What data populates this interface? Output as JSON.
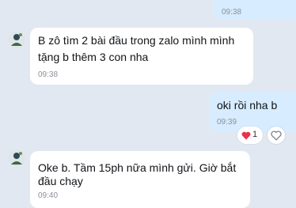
{
  "chat": {
    "messages": [
      {
        "sender": "self",
        "time": "09:38"
      },
      {
        "sender": "contact",
        "lines": [
          "B zô tìm 2 bài đầu trong zalo mình mình",
          "tặng b thêm 3 con nha"
        ],
        "time": "09:38"
      },
      {
        "sender": "self",
        "lines": [
          "oki rồi nha b"
        ],
        "time": "09:39",
        "reaction": {
          "icon": "heart-icon",
          "count": "1"
        }
      },
      {
        "sender": "contact",
        "lines": [
          "Oke b. Tầm 15ph nữa mình gửi. Giờ bắt",
          "đầu chạy"
        ],
        "time": "09:40"
      }
    ]
  },
  "colors": {
    "background": "#e2e8f1",
    "incoming_bubble": "#ffffff",
    "outgoing_bubble": "#d7ecff",
    "timestamp": "#8a9099",
    "heart": "#e8334a"
  }
}
